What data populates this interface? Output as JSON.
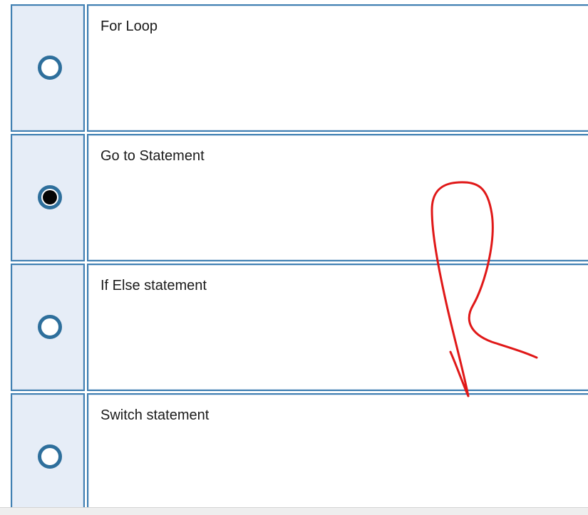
{
  "question": {
    "options": [
      {
        "label": "For Loop",
        "selected": false
      },
      {
        "label": "Go to Statement",
        "selected": true
      },
      {
        "label": "If Else statement",
        "selected": false
      },
      {
        "label": "Switch statement",
        "selected": false
      }
    ]
  },
  "annotation": {
    "type": "handwritten-mark",
    "color": "#e01818"
  },
  "colors": {
    "border": "#3f7fb2",
    "radio_cell_bg": "#e6edf7",
    "radio_ring": "#2e6f9c"
  }
}
